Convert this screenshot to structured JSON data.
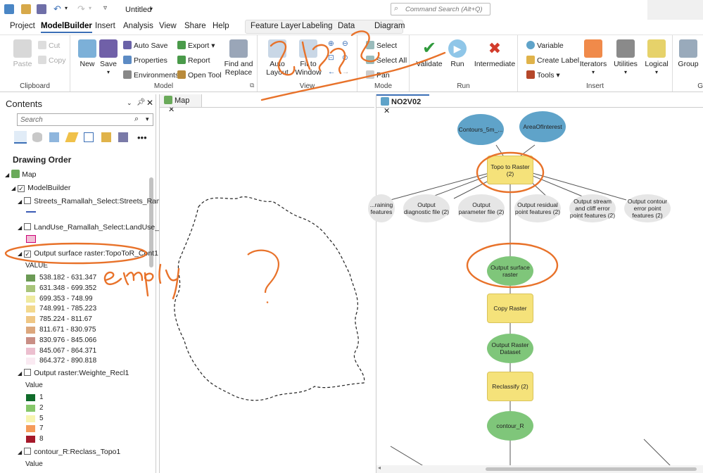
{
  "qat": {
    "title": "Untitled",
    "search_placeholder": "Command Search (Alt+Q)"
  },
  "tabs": [
    "Project",
    "ModelBuilder",
    "Insert",
    "Analysis",
    "View",
    "Share",
    "Help",
    "Feature Layer",
    "Labeling",
    "Data",
    "Diagram"
  ],
  "ribbon": {
    "clipboard": {
      "paste": "Paste",
      "cut": "Cut",
      "copy": "Copy",
      "label": "Clipboard"
    },
    "model": {
      "new": "New",
      "save": "Save",
      "auto_save": "Auto Save",
      "properties": "Properties",
      "environments": "Environments",
      "export": "Export",
      "report": "Report",
      "open_tool": "Open Tool",
      "find_replace": "Find and Replace",
      "label": "Model"
    },
    "view": {
      "auto_layout": "Auto Layout",
      "fit_window": "Fit to Window",
      "label": "View"
    },
    "mode": {
      "select": "Select",
      "select_all": "Select All",
      "pan": "Pan",
      "label": "Mode"
    },
    "run": {
      "validate": "Validate",
      "run": "Run",
      "intermediate": "Intermediate",
      "label": "Run"
    },
    "insert": {
      "variable": "Variable",
      "create_label": "Create Label",
      "tools": "Tools",
      "iterators": "Iterators",
      "utilities": "Utilities",
      "logical": "Logical",
      "label": "Insert"
    },
    "group": {
      "group": "Group",
      "label": "G"
    }
  },
  "contents": {
    "title": "Contents",
    "search_placeholder": "Search",
    "drawing_order": "Drawing Order",
    "map": "Map",
    "modelbuilder": "ModelBuilder",
    "layer1": "Streets_Ramallah_Select:Streets_Ram...",
    "layer2": "LandUse_Ramallah_Select:LandUse_R...",
    "layer3": "Output surface raster:TopoToR_Cont1",
    "layer3_legend_title": "VALUE",
    "layer3_legend": [
      {
        "label": "538.182 - 631.347",
        "color": "#6b9a55"
      },
      {
        "label": "631.348 - 699.352",
        "color": "#a8c47a"
      },
      {
        "label": "699.353 - 748.99",
        "color": "#efeaa0"
      },
      {
        "label": "748.991 - 785.223",
        "color": "#f3d98e"
      },
      {
        "label": "785.224 - 811.67",
        "color": "#efc785"
      },
      {
        "label": "811.671 - 830.975",
        "color": "#dca77d"
      },
      {
        "label": "830.976 - 845.066",
        "color": "#c98e85"
      },
      {
        "label": "845.067 - 864.371",
        "color": "#ecbfcf"
      },
      {
        "label": "864.372 - 890.818",
        "color": "#faeaf2"
      }
    ],
    "layer4": "Output raster:Weighte_Recl1",
    "layer4_legend_title": "Value",
    "layer4_legend": [
      {
        "label": "1",
        "color": "#0f6b2a"
      },
      {
        "label": "2",
        "color": "#86c76a"
      },
      {
        "label": "5",
        "color": "#f7f4b0"
      },
      {
        "label": "7",
        "color": "#f59b5a"
      },
      {
        "label": "8",
        "color": "#a5182a"
      }
    ],
    "layer5": "contour_R:Reclass_Topo1",
    "layer5_legend_title": "Value"
  },
  "mapview": {
    "tab": "Map"
  },
  "modelview": {
    "tab": "NO2V02"
  },
  "model": {
    "contours": "Contours_5m_...",
    "aoi": "AreaOfInterest",
    "topo": "Topo to Raster (2)",
    "o_training": "...raining features",
    "o_diag": "Output diagnostic file (2)",
    "o_param": "Output parameter file (2)",
    "o_resid": "Output residual point features (2)",
    "o_stream": "Output stream and cliff error point features (2)",
    "o_contour": "Output contour error point features (2)",
    "o_surface": "Output surface raster",
    "copy": "Copy Raster",
    "o_raster": "Output Raster Dataset",
    "reclass": "Reclassify (2)",
    "contour_r": "contour_R"
  },
  "annotations": {
    "empty": "empty",
    "question": "?",
    "scribble": "3-4-2"
  }
}
